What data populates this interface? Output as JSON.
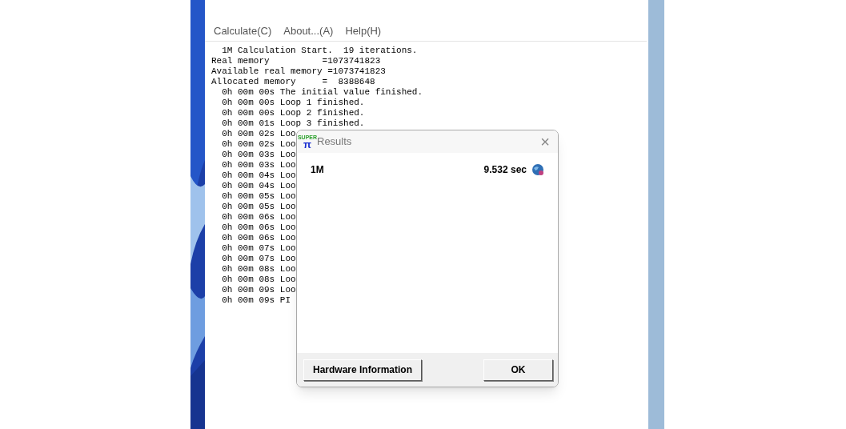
{
  "menu": [
    {
      "label": "Calculate(C)"
    },
    {
      "label": "About...(A)"
    },
    {
      "label": "Help(H)"
    }
  ],
  "log": [
    "  1M Calculation Start.  19 iterations.",
    "Real memory          =1073741823",
    "Available real memory =1073741823",
    "Allocated memory     =  8388648",
    "  0h 00m 00s The initial value finished.",
    "  0h 00m 00s Loop 1 finished.",
    "  0h 00m 00s Loop 2 finished.",
    "  0h 00m 01s Loop 3 finished.",
    "  0h 00m 02s Loo",
    "  0h 00m 02s Loo",
    "  0h 00m 03s Loo",
    "  0h 00m 03s Loo",
    "  0h 00m 04s Loo",
    "  0h 00m 04s Loo",
    "  0h 00m 05s Loo",
    "  0h 00m 05s Loo",
    "  0h 00m 06s Loo",
    "  0h 00m 06s Loo",
    "  0h 00m 06s Loo",
    "  0h 00m 07s Loo",
    "  0h 00m 07s Loo",
    "  0h 00m 08s Loo",
    "  0h 00m 08s Loo",
    "  0h 00m 09s Loo",
    "  0h 00m 09s PI"
  ],
  "dialog": {
    "logo_top": "SUPER",
    "logo_bottom": "π",
    "title": "Results",
    "close": "×",
    "results": [
      {
        "label": "1M",
        "time": "9.532 sec"
      }
    ],
    "buttons": [
      {
        "label": "Hardware Information",
        "kind": "left"
      },
      {
        "label": "OK",
        "kind": "right"
      }
    ]
  }
}
